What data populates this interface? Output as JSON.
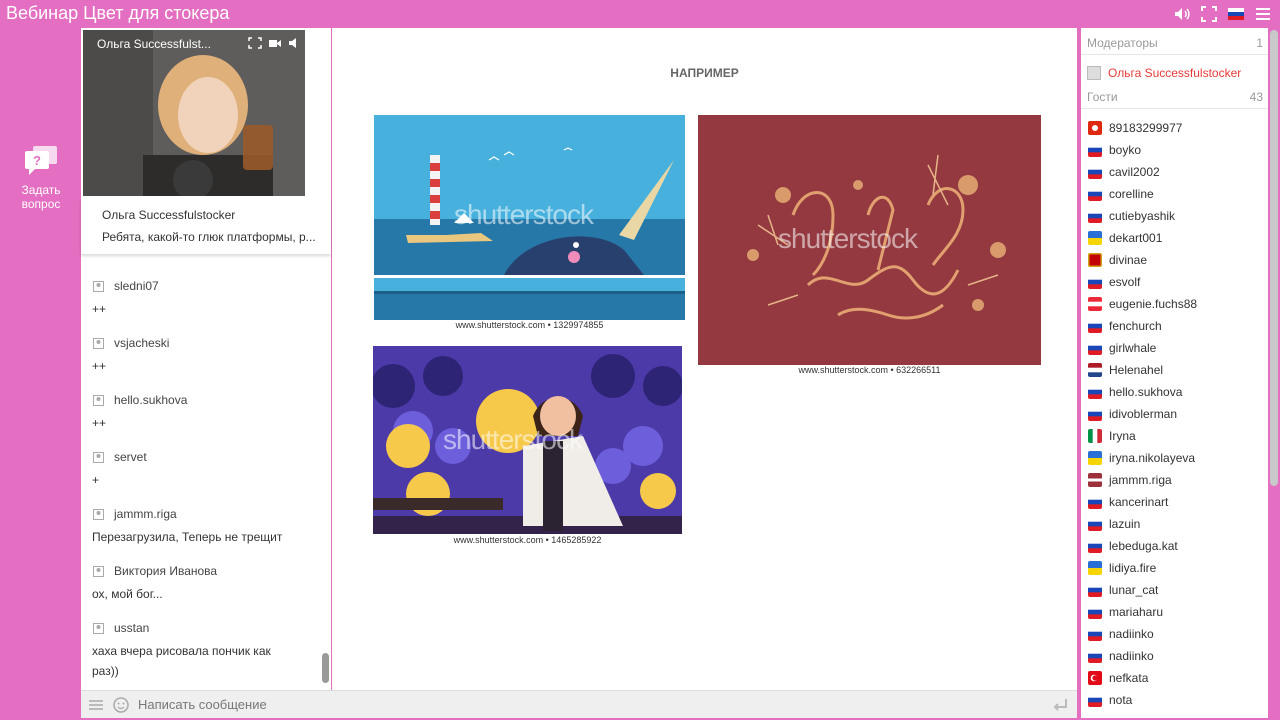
{
  "window": {
    "title": "Вебинар Цвет для стокера"
  },
  "left_rail": {
    "ask_label": "Задать вопрос"
  },
  "video": {
    "presenter": "Ольга Successfulst..."
  },
  "pinned": {
    "name": "Ольга Successfulstocker",
    "text": "Ребята, какой-то глюк платформы, р..."
  },
  "chat": {
    "messages": [
      {
        "user": "sledni07",
        "text": "++"
      },
      {
        "user": "vsjacheski",
        "text": "++"
      },
      {
        "user": "hello.sukhova",
        "text": "++"
      },
      {
        "user": "servet",
        "text": "+"
      },
      {
        "user": "jammm.riga",
        "text": "Перезагрузила, Теперь не трещит"
      },
      {
        "user": "Виктория Иванова",
        "text": "ох, мой бог..."
      },
      {
        "user": "usstan",
        "text": "хаха вчера рисовала пончик как раз))"
      }
    ],
    "input_placeholder": "Написать сообщение"
  },
  "slide": {
    "heading": "НАПРИМЕР",
    "images": [
      {
        "name": "narwhal",
        "watermark": "shutterstock",
        "caption": "www.shutterstock.com • 1329974855"
      },
      {
        "name": "mothers-day",
        "watermark": "shutterstock",
        "caption": "www.shutterstock.com • 632266511"
      },
      {
        "name": "lanterns",
        "watermark": "shutterstock",
        "caption": "www.shutterstock.com • 1465285922"
      }
    ]
  },
  "sidebar": {
    "moderators_label": "Модераторы",
    "moderators_count": "1",
    "moderator": "Ольга Successfulstocker",
    "guests_label": "Гости",
    "guests_count": "43",
    "guests": [
      {
        "name": "89183299977",
        "flag": "hk"
      },
      {
        "name": "boyko",
        "flag": "ru"
      },
      {
        "name": "cavil2002",
        "flag": "ru"
      },
      {
        "name": "corelline",
        "flag": "ru"
      },
      {
        "name": "cutiebyashik",
        "flag": "ru"
      },
      {
        "name": "dekart001",
        "flag": "ua"
      },
      {
        "name": "divinae",
        "flag": "me"
      },
      {
        "name": "esvolf",
        "flag": "ru"
      },
      {
        "name": "eugenie.fuchs88",
        "flag": "at"
      },
      {
        "name": "fenchurch",
        "flag": "ru"
      },
      {
        "name": "girlwhale",
        "flag": "ru"
      },
      {
        "name": "Helenahel",
        "flag": "nl"
      },
      {
        "name": "hello.sukhova",
        "flag": "ru"
      },
      {
        "name": "idivoblerman",
        "flag": "ru"
      },
      {
        "name": "Iryna",
        "flag": "it"
      },
      {
        "name": "iryna.nikolayeva",
        "flag": "ua"
      },
      {
        "name": "jammm.riga",
        "flag": "lv"
      },
      {
        "name": "kancerinart",
        "flag": "ru"
      },
      {
        "name": "lazuin",
        "flag": "ru"
      },
      {
        "name": "lebeduga.kat",
        "flag": "ru"
      },
      {
        "name": "lidiya.fire",
        "flag": "ua"
      },
      {
        "name": "lunar_cat",
        "flag": "ru"
      },
      {
        "name": "mariaharu",
        "flag": "ru"
      },
      {
        "name": "nadiinko",
        "flag": "ru"
      },
      {
        "name": "nadiinko",
        "flag": "ru"
      },
      {
        "name": "nefkata",
        "flag": "tr"
      },
      {
        "name": "nota",
        "flag": "ru"
      }
    ]
  },
  "colors": {
    "brand": "#e46ec1",
    "moderator": "#e83a3a"
  }
}
